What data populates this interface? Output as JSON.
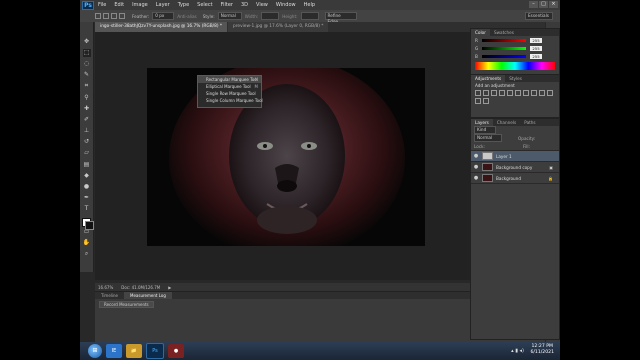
{
  "app": {
    "logo": "Ps",
    "menu": [
      "File",
      "Edit",
      "Image",
      "Layer",
      "Type",
      "Select",
      "Filter",
      "3D",
      "View",
      "Window",
      "Help"
    ],
    "window_controls": [
      "–",
      "□",
      "×"
    ]
  },
  "options_bar": {
    "feather_label": "Feather:",
    "feather_value": "0 px",
    "antialias_label": "Anti-alias",
    "style_label": "Style:",
    "style_value": "Normal",
    "width_label": "Width:",
    "height_label": "Height:",
    "refine_edge_label": "Refine Edge...",
    "workspace_value": "Essentials"
  },
  "document_tabs": [
    {
      "label": "ingo-stiller-38athJQzv7Y-unsplash.jpg @ 16.7% (RGB/8) *",
      "active": true
    },
    {
      "label": "preview-1.jpg @ 17.6% (Layer 0, RGB/8) *",
      "active": false
    }
  ],
  "tool_flyout": [
    {
      "label": "Rectangular Marquee Tool",
      "shortcut": "M",
      "highlighted": true
    },
    {
      "label": "Elliptical Marquee Tool",
      "shortcut": "M",
      "highlighted": false
    },
    {
      "label": "Single Row Marquee Tool",
      "shortcut": "",
      "highlighted": false
    },
    {
      "label": "Single Column Marquee Tool",
      "shortcut": "",
      "highlighted": false
    }
  ],
  "tools": [
    "move-icon",
    "marquee-icon",
    "lasso-icon",
    "quick-select-icon",
    "crop-icon",
    "eyedropper-icon",
    "healing-icon",
    "brush-icon",
    "clone-stamp-icon",
    "history-brush-icon",
    "eraser-icon",
    "gradient-icon",
    "blur-icon",
    "dodge-icon",
    "pen-icon",
    "type-icon",
    "path-select-icon",
    "shape-icon",
    "hand-icon",
    "zoom-icon"
  ],
  "status": {
    "zoom": "16.67%",
    "doc": "Doc: 41.0M/126.7M"
  },
  "bottom_panel": {
    "tabs": [
      {
        "label": "Timeline",
        "active": false
      },
      {
        "label": "Measurement Log",
        "active": true
      }
    ],
    "record_button": "Record Measurements"
  },
  "color_panel": {
    "tabs": [
      {
        "label": "Color",
        "active": true
      },
      {
        "label": "Swatches",
        "active": false
      }
    ],
    "sliders": [
      {
        "label": "R",
        "value": "255",
        "color": "#ff4040"
      },
      {
        "label": "G",
        "value": "255",
        "color": "#40ff40"
      },
      {
        "label": "B",
        "value": "255",
        "color": "#4070ff"
      }
    ]
  },
  "adjustments_panel": {
    "tabs": [
      {
        "label": "Adjustments",
        "active": true
      },
      {
        "label": "Styles",
        "active": false
      }
    ],
    "heading": "Add an adjustment"
  },
  "layers_panel": {
    "tabs": [
      {
        "label": "Layers",
        "active": true
      },
      {
        "label": "Channels",
        "active": false
      },
      {
        "label": "Paths",
        "active": false
      }
    ],
    "kind_filter": "Kind",
    "blend_mode": "Normal",
    "opacity_label": "Opacity:",
    "lock_label": "Lock:",
    "fill_label": "Fill:",
    "layers": [
      {
        "name": "Layer 1",
        "selected": true,
        "thumb": "#c9c9c9"
      },
      {
        "name": "Background copy",
        "selected": false,
        "thumb": "#3a1414"
      },
      {
        "name": "Background",
        "selected": false,
        "thumb": "#3a1414"
      }
    ]
  },
  "taskbar": {
    "apps": [
      {
        "label": "IE",
        "color": "#2b74c9"
      },
      {
        "label": "📁",
        "color": "#c99a2b"
      },
      {
        "label": "Ps",
        "color": "#0b2b4d"
      },
      {
        "label": "●",
        "color": "#7a2222"
      }
    ],
    "time": "12:27 PM",
    "date": "6/11/2021"
  }
}
